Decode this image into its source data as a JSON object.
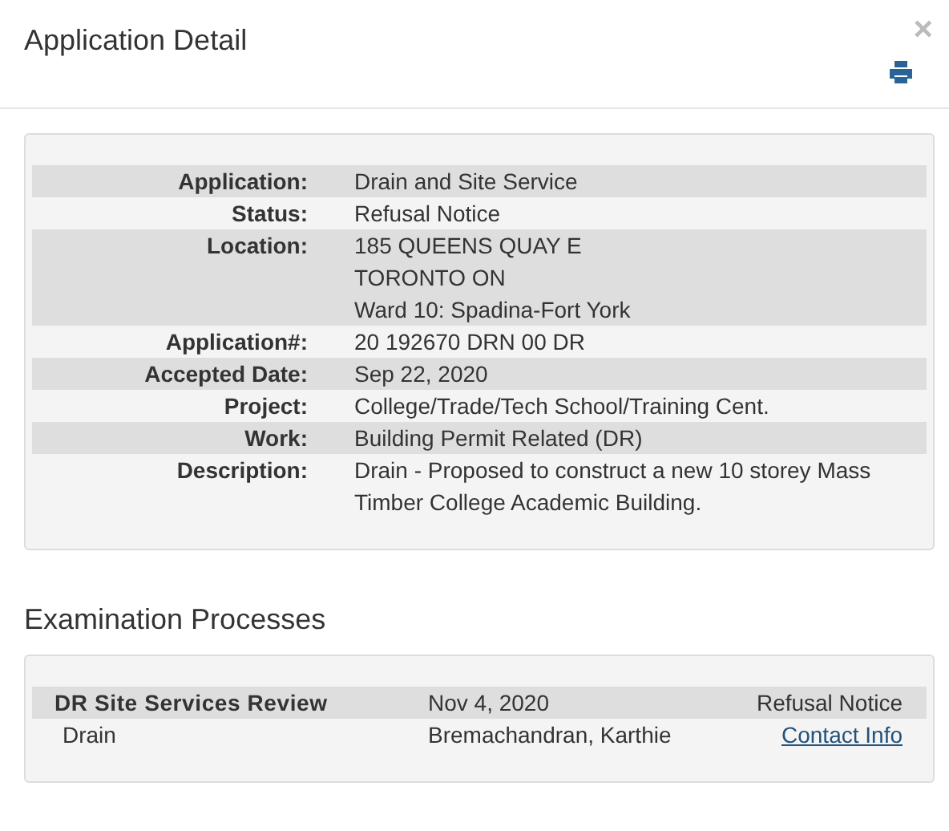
{
  "dialog": {
    "title": "Application Detail",
    "close": "×"
  },
  "details": [
    {
      "label": "Application:",
      "lines": [
        "Drain and Site Service"
      ]
    },
    {
      "label": "Status:",
      "lines": [
        "Refusal Notice"
      ]
    },
    {
      "label": "Location:",
      "lines": [
        "185 QUEENS QUAY E",
        "TORONTO ON",
        "Ward 10: Spadina-Fort York"
      ]
    },
    {
      "label": "Application#:",
      "lines": [
        "20 192670 DRN 00 DR"
      ]
    },
    {
      "label": "Accepted Date:",
      "lines": [
        "Sep 22, 2020"
      ]
    },
    {
      "label": "Project:",
      "lines": [
        "College/Trade/Tech School/Training Cent."
      ]
    },
    {
      "label": "Work:",
      "lines": [
        "Building Permit Related (DR)"
      ]
    },
    {
      "label": "Description:",
      "lines": [
        "Drain - Proposed to construct a new 10 storey Mass Timber College Academic Building."
      ]
    }
  ],
  "examination": {
    "heading": "Examination Processes",
    "processes": [
      {
        "name": "DR Site Services Review",
        "date": "Nov 4, 2020",
        "status": "Refusal Notice",
        "type": "Drain",
        "examiner": "Bremachandran, Karthie",
        "link": "Contact Info"
      }
    ]
  }
}
